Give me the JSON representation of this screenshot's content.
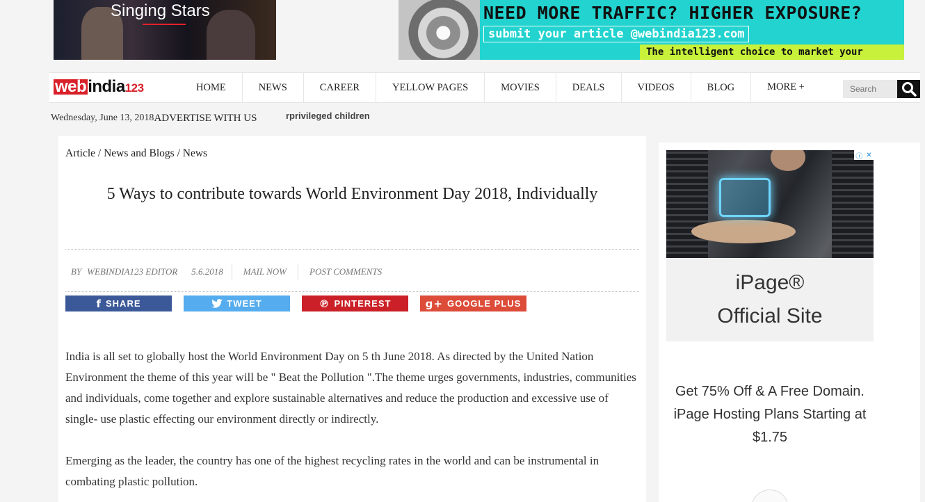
{
  "banners": {
    "left_title": "Singing Stars",
    "right_headline": "NEED MORE TRAFFIC? HIGHER EXPOSURE?",
    "right_submit": "submit your article @webindia123.com",
    "right_tagline": "The intelligent choice to market your articles"
  },
  "logo": {
    "part1": "web",
    "part2": "india",
    "part3": "123"
  },
  "nav": {
    "items": [
      "HOME",
      "NEWS",
      "CAREER",
      "YELLOW PAGES",
      "MOVIES",
      "DEALS",
      "VIDEOS",
      "BLOG"
    ],
    "more": "MORE +",
    "search_placeholder": "Search"
  },
  "dateline": {
    "date": "Wednesday, June 13, 2018",
    "advertise": "ADVERTISE WITH US",
    "ticker": "rprivileged children"
  },
  "article": {
    "breadcrumb": [
      "Article",
      "News and Blogs",
      "News"
    ],
    "breadcrumb_sep": " / ",
    "headline": "5 Ways to contribute towards World Environment Day 2018, Individually",
    "meta": {
      "by": "BY",
      "author": "WEBINDIA123 EDITOR",
      "date": "5.6.2018",
      "mail": "MAIL NOW",
      "comments": "POST COMMENTS"
    },
    "share": [
      {
        "label": "SHARE",
        "icon": "f",
        "color": "#3b5998"
      },
      {
        "label": "TWEET",
        "icon": "🐦",
        "color": "#55acee"
      },
      {
        "label": "PINTEREST",
        "icon": "℗",
        "color": "#cb2027"
      },
      {
        "label": "GOOGLE PLUS",
        "icon": "g+",
        "color": "#dd4b39"
      }
    ],
    "paragraphs": [
      "India is all set to globally host the World Environment Day on 5 th June 2018. As directed by the United Nation Environment the theme of this year will be \" Beat the Pollution \".The theme urges governments, industries, communities and individuals, come together and explore sustainable alternatives and reduce the production and excessive use of single- use plastic effecting our environment directly or indirectly.",
      "Emerging as the leader, the country has one of the highest recycling rates in the world and can be instrumental in combating plastic pollution."
    ]
  },
  "ad": {
    "title_line1": "iPage®",
    "title_line2": "Official Site",
    "desc": "Get 75% Off & A Free Domain. iPage Hosting Plans Starting at $1.75"
  }
}
